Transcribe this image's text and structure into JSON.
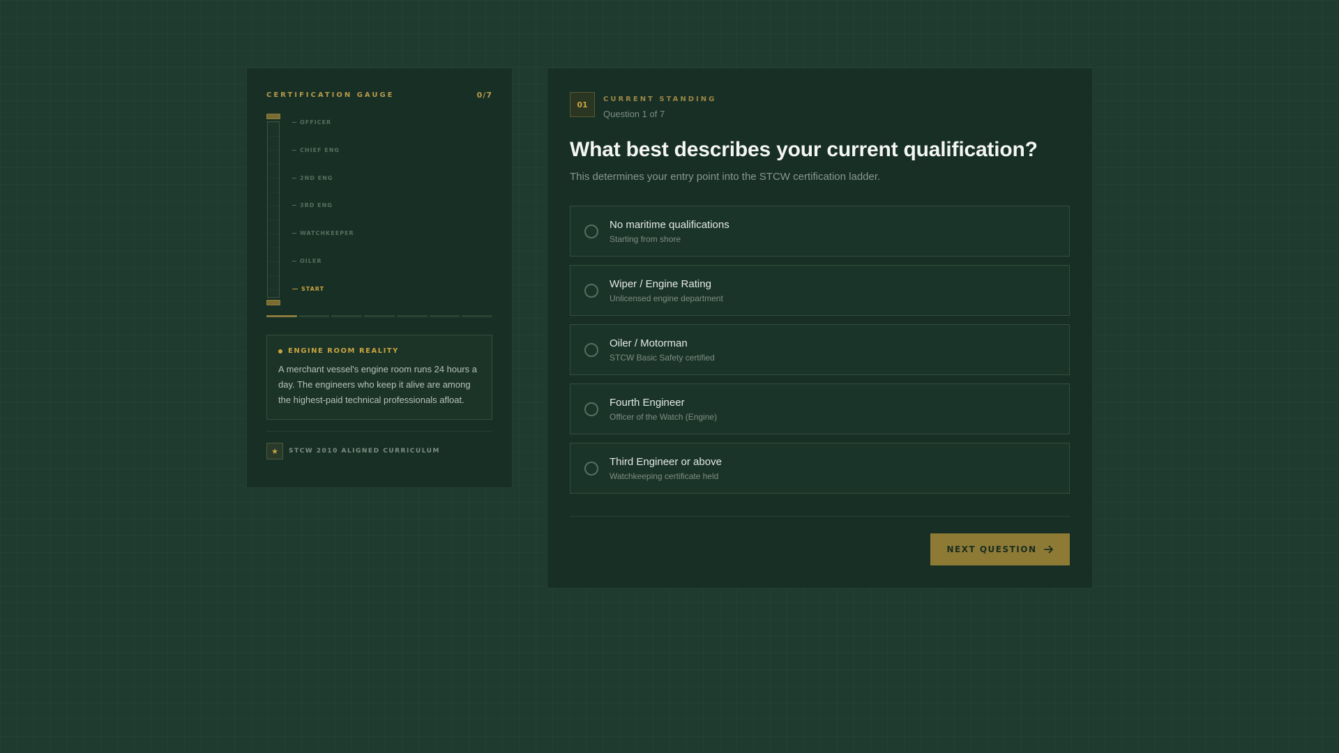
{
  "gauge": {
    "title": "CERTIFICATION GAUGE",
    "count": "0/7",
    "progress": 0,
    "rungs": [
      "OFFICER",
      "CHIEF ENG",
      "2ND ENG",
      "3RD ENG",
      "WATCHKEEPER",
      "OILER",
      "START"
    ],
    "active_rung": "START",
    "segments_total": 7,
    "segments_filled": 1
  },
  "fact": {
    "title": "ENGINE ROOM REALITY",
    "text": "A merchant vessel's engine room runs 24 hours a day. The engineers who keep it alive are among the highest-paid technical professionals afloat."
  },
  "footer": {
    "badge_icon": "star-icon",
    "text": "STCW 2010 ALIGNED CURRICULUM"
  },
  "standing": {
    "number": "01",
    "label": "CURRENT STANDING",
    "subtitle": "Question 1 of 7"
  },
  "question": {
    "title": "What best describes your current qualification?",
    "subtitle": "This determines your entry point into the STCW certification ladder."
  },
  "options": [
    {
      "title": "No maritime qualifications",
      "desc": "Starting from shore",
      "selected": false
    },
    {
      "title": "Wiper / Engine Rating",
      "desc": "Unlicensed engine department",
      "selected": false
    },
    {
      "title": "Oiler / Motorman",
      "desc": "STCW Basic Safety certified",
      "selected": false
    },
    {
      "title": "Fourth Engineer",
      "desc": "Officer of the Watch (Engine)",
      "selected": false
    },
    {
      "title": "Third Engineer or above",
      "desc": "Watchkeeping certificate held",
      "selected": false
    }
  ],
  "next_button": {
    "label": "NEXT QUESTION",
    "icon": "arrow-right-icon"
  },
  "colors": {
    "background": "#1f3a2e",
    "panel": "#172f25",
    "accent": "#c9a540",
    "button": "#8c7a35"
  }
}
